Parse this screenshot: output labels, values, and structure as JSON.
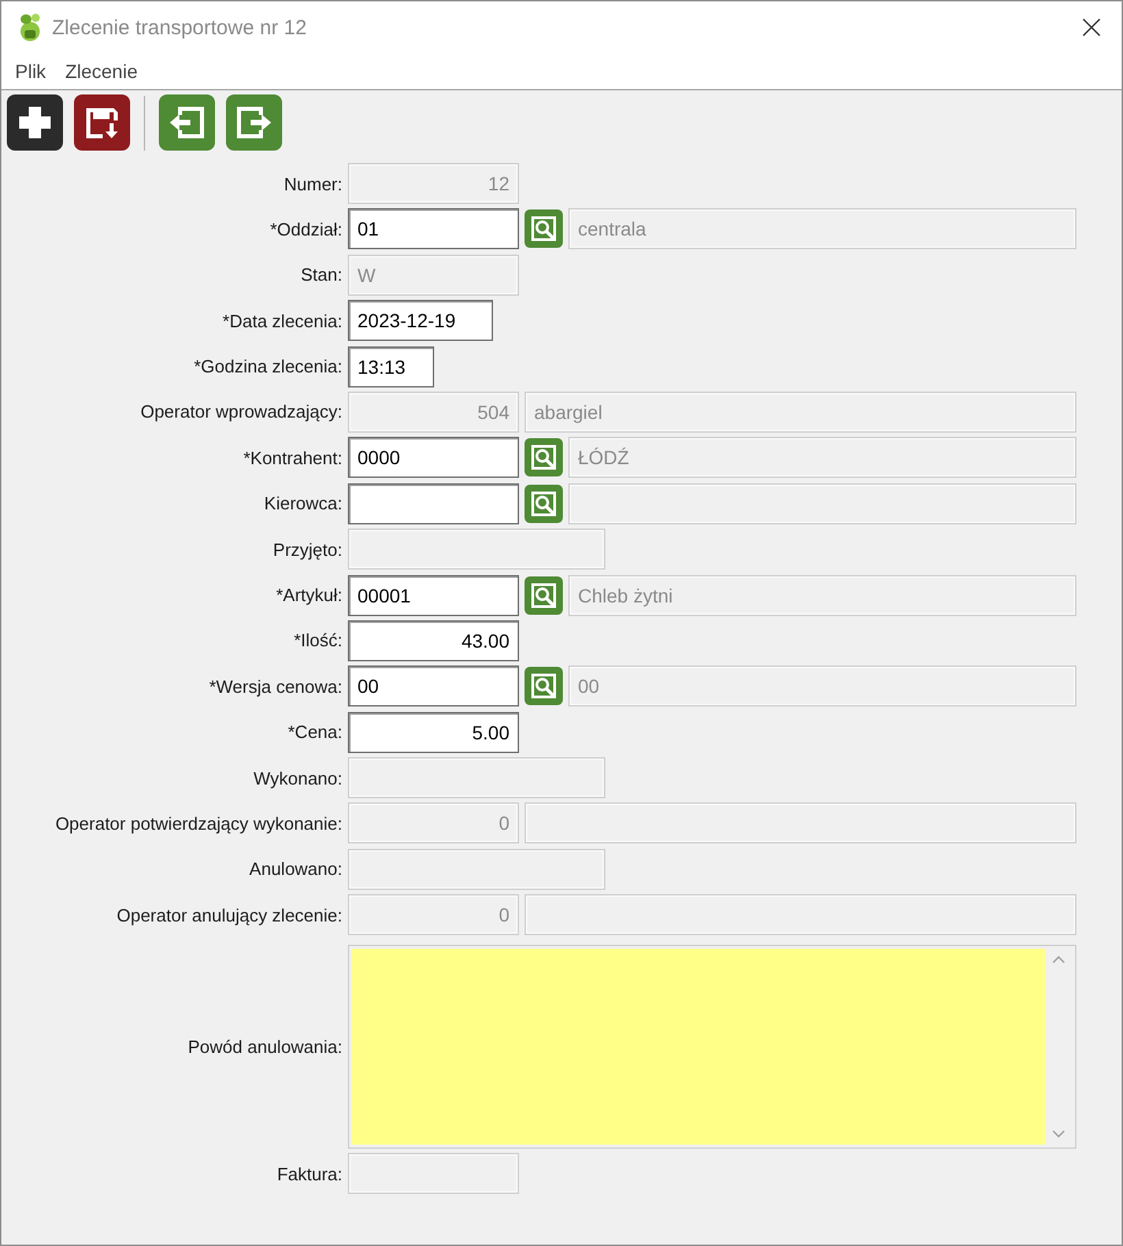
{
  "window": {
    "title": "Zlecenie transportowe nr 12"
  },
  "menu": [
    {
      "label": "Plik"
    },
    {
      "label": "Zlecenie"
    }
  ],
  "toolbar": [
    {
      "kind": "add"
    },
    {
      "kind": "save"
    },
    {
      "kind": "separator"
    },
    {
      "kind": "previous"
    },
    {
      "kind": "next"
    }
  ],
  "form": {
    "rows": [
      {
        "label": "Numer:",
        "kind": "code",
        "editable": false,
        "numeric": true,
        "value": "12"
      },
      {
        "label": "*Oddział:",
        "kind": "code",
        "editable": true,
        "numeric": false,
        "value": "01",
        "lookup": true,
        "detail": {
          "value": "centrala"
        }
      },
      {
        "label": "Stan:",
        "kind": "code",
        "editable": false,
        "numeric": false,
        "value": "W"
      },
      {
        "label": "*Data zlecenia:",
        "kind": "date",
        "editable": true,
        "numeric": false,
        "value": "2023-12-19"
      },
      {
        "label": "*Godzina zlecenia:",
        "kind": "time",
        "editable": true,
        "numeric": false,
        "value": "13:13"
      },
      {
        "label": "Operator wprowadzający:",
        "kind": "code",
        "editable": false,
        "numeric": true,
        "value": "504",
        "detail": {
          "value": "abargiel"
        }
      },
      {
        "label": "*Kontrahent:",
        "kind": "code",
        "editable": true,
        "numeric": false,
        "value": "0000",
        "lookup": true,
        "detail": {
          "value": "ŁÓDŹ"
        }
      },
      {
        "label": "Kierowca:",
        "kind": "code",
        "editable": true,
        "numeric": false,
        "lookup": true,
        "detail": {}
      },
      {
        "label": "Przyjęto:",
        "kind": "wide",
        "editable": false
      },
      {
        "label": "*Artykuł:",
        "kind": "code",
        "editable": true,
        "numeric": false,
        "value": "00001",
        "lookup": true,
        "detail": {
          "value": "Chleb żytni"
        }
      },
      {
        "label": "*Ilość:",
        "kind": "code",
        "editable": true,
        "numeric": true,
        "value": "43.00"
      },
      {
        "label": "*Wersja cenowa:",
        "kind": "code",
        "editable": true,
        "numeric": false,
        "value": "00",
        "lookup": true,
        "detail": {
          "value": "00"
        }
      },
      {
        "label": "*Cena:",
        "kind": "code",
        "editable": true,
        "numeric": true,
        "value": "5.00"
      },
      {
        "label": "Wykonano:",
        "kind": "wide",
        "editable": false
      },
      {
        "label": "Operator potwierdzający wykonanie:",
        "kind": "code",
        "editable": false,
        "numeric": true,
        "value": "0",
        "detail": {}
      },
      {
        "label": "Anulowano:",
        "kind": "wide",
        "editable": false
      },
      {
        "label": "Operator anulujący zlecenie:",
        "kind": "code",
        "editable": false,
        "numeric": true,
        "value": "0",
        "detail": {}
      },
      {
        "label": "Powód anulowania:",
        "kind": "memo",
        "editable": true
      },
      {
        "label": "Faktura:",
        "kind": "code",
        "editable": false
      }
    ]
  }
}
